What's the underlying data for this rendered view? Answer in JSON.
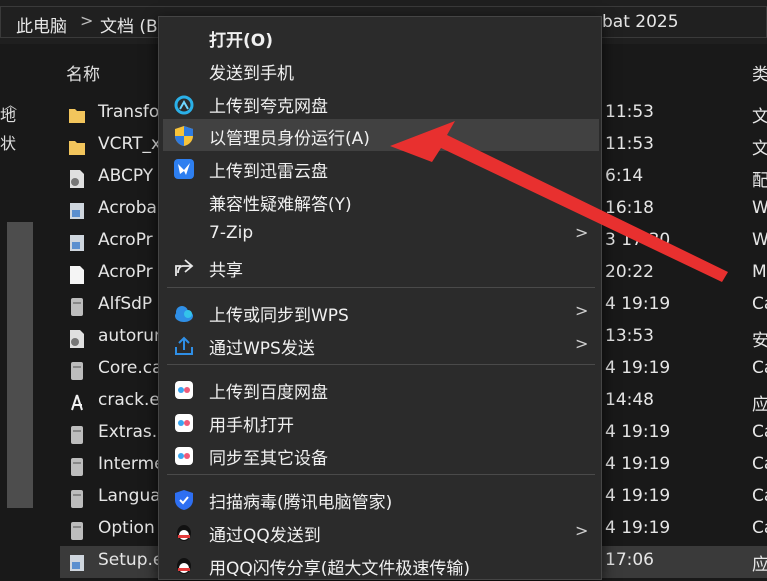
{
  "address": {
    "crumbs": [
      "此电脑",
      "文档 (B",
      "bat 2025"
    ],
    "separators": [
      ">",
      ">"
    ]
  },
  "navpane": {
    "labels": [
      "地",
      "状"
    ]
  },
  "list": {
    "header_name": "名称",
    "header_type": "类",
    "rows": [
      {
        "name": "Transfo",
        "date": "11:53",
        "type": "文",
        "icon": "folder-icon"
      },
      {
        "name": "VCRT_x",
        "date": "11:53",
        "type": "文",
        "icon": "folder-icon"
      },
      {
        "name": "ABCPY",
        "date": "6:14",
        "type": "配",
        "icon": "settings-file-icon"
      },
      {
        "name": "Acroba",
        "date": "16:18",
        "type": "W",
        "icon": "installer-icon"
      },
      {
        "name": "AcroPr",
        "date": "3 17:30",
        "type": "W",
        "icon": "installer-icon"
      },
      {
        "name": "AcroPr",
        "date": "20:22",
        "type": "M",
        "icon": "file-icon"
      },
      {
        "name": "AlfSdP",
        "date": "4 19:19",
        "type": "Ca",
        "icon": "cabinet-icon"
      },
      {
        "name": "autorun",
        "date": "13:53",
        "type": "安",
        "icon": "settings-file-icon"
      },
      {
        "name": "Core.ca",
        "date": "4 19:19",
        "type": "Ca",
        "icon": "cabinet-icon"
      },
      {
        "name": "crack.e",
        "date": "14:48",
        "type": "应",
        "icon": "acrobat-icon"
      },
      {
        "name": "Extras.c",
        "date": "4 19:19",
        "type": "Ca",
        "icon": "cabinet-icon"
      },
      {
        "name": "Interme",
        "date": "4 19:19",
        "type": "Ca",
        "icon": "cabinet-icon"
      },
      {
        "name": "Langua",
        "date": "4 19:19",
        "type": "Ca",
        "icon": "cabinet-icon"
      },
      {
        "name": "Option",
        "date": "4 19:19",
        "type": "Ca",
        "icon": "cabinet-icon"
      },
      {
        "name": "Setup.e",
        "date": "17:06",
        "type": "应",
        "icon": "installer-icon"
      }
    ]
  },
  "menu": {
    "items": [
      {
        "label": "打开(O)",
        "icon": "",
        "bold": true
      },
      {
        "label": "发送到手机",
        "icon": ""
      },
      {
        "label": "上传到夸克网盘",
        "icon": "quark-cloud-icon"
      },
      {
        "label": "以管理员身份运行(A)",
        "icon": "uac-shield-icon",
        "highlight": true
      },
      {
        "label": "上传到迅雷云盘",
        "icon": "xunlei-icon"
      },
      {
        "label": "兼容性疑难解答(Y)",
        "icon": ""
      },
      {
        "label": "7-Zip",
        "icon": "",
        "submenu": true
      },
      {
        "label": "共享",
        "icon": "share-icon"
      },
      {
        "label": "上传或同步到WPS",
        "icon": "wps-cloud-icon",
        "submenu": true
      },
      {
        "label": "通过WPS发送",
        "icon": "wps-send-icon",
        "submenu": true
      },
      {
        "label": "上传到百度网盘",
        "icon": "baidu-icon"
      },
      {
        "label": "用手机打开",
        "icon": "baidu-icon"
      },
      {
        "label": "同步至其它设备",
        "icon": "baidu-icon"
      },
      {
        "label": "扫描病毒(腾讯电脑管家)",
        "icon": "tencent-shield-icon"
      },
      {
        "label": "通过QQ发送到",
        "icon": "qq-icon",
        "submenu": true
      },
      {
        "label": "用QQ闪传分享(超大文件极速传输)",
        "icon": "qq-icon"
      }
    ],
    "submenu_glyph": ">"
  },
  "colors": {
    "arrow": "#e8302f",
    "highlight": "#414141",
    "menu_bg": "#2b2b2b"
  }
}
